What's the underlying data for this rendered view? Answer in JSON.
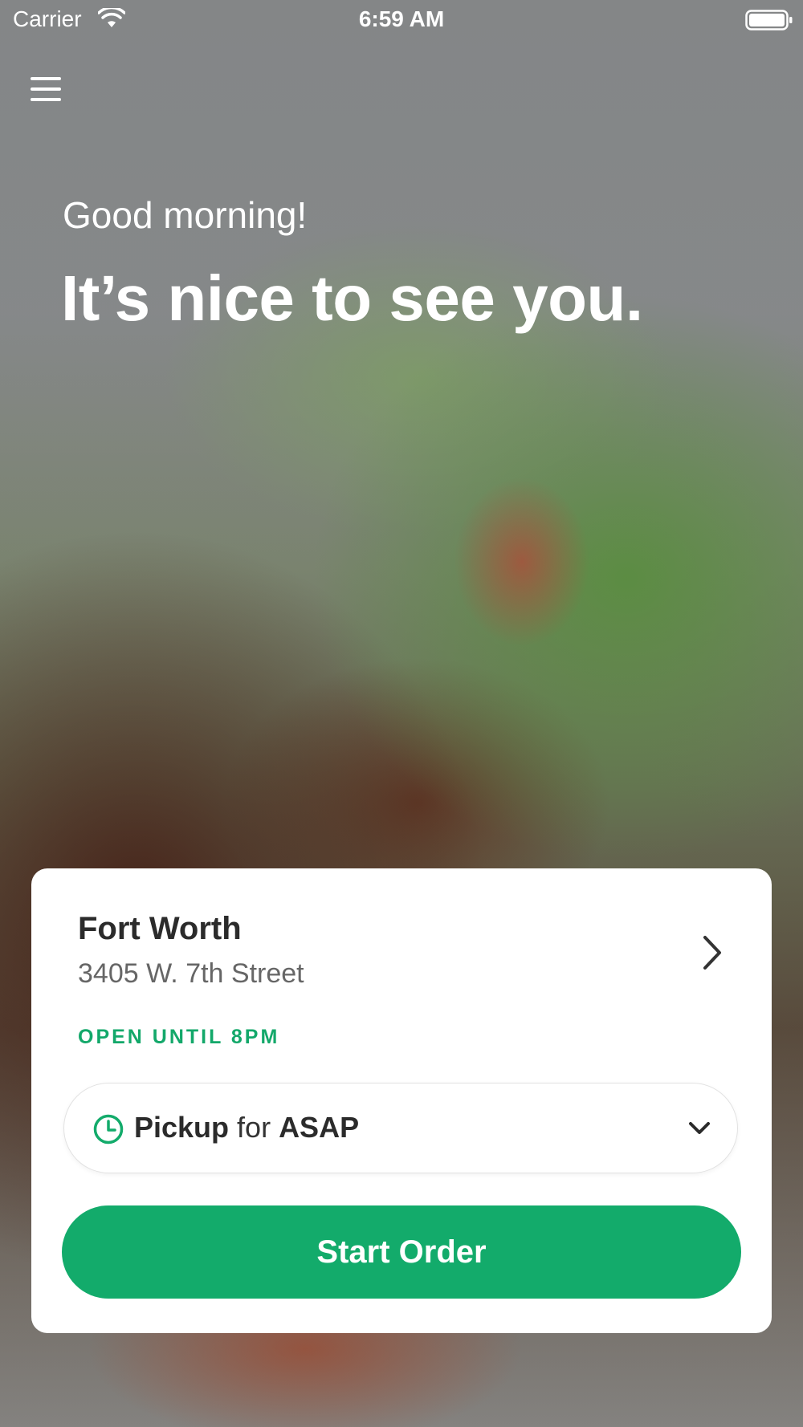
{
  "status_bar": {
    "carrier": "Carrier",
    "time": "6:59 AM"
  },
  "header": {
    "menu_icon": "hamburger-menu-icon"
  },
  "hero": {
    "greeting": "Good morning!",
    "headline": "It’s nice to see you."
  },
  "location_card": {
    "name": "Fort Worth",
    "address": "3405 W. 7th Street",
    "hours": "OPEN UNTIL 8PM",
    "order_type": {
      "mode": "Pickup",
      "connector": "for",
      "time": "ASAP"
    },
    "start_button_label": "Start Order"
  },
  "colors": {
    "accent": "#13ab6b",
    "text_dark": "#2b2b2b",
    "text_muted": "#666666"
  }
}
